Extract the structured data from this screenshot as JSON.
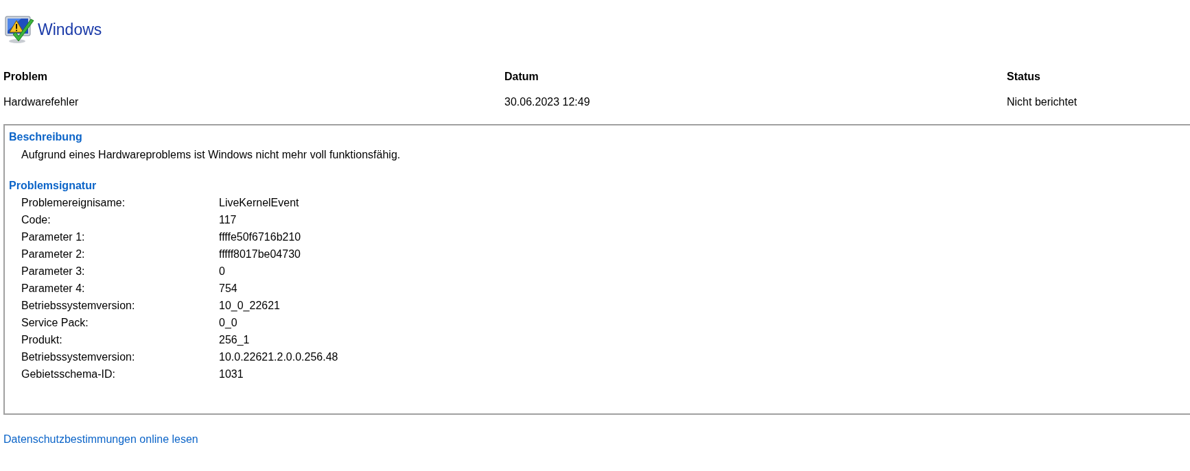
{
  "header": {
    "title": "Windows"
  },
  "columns": [
    {
      "heading": "Problem",
      "value": "Hardwarefehler"
    },
    {
      "heading": "Datum",
      "value": "30.06.2023 12:49"
    },
    {
      "heading": "Status",
      "value": "Nicht berichtet"
    }
  ],
  "details": {
    "description_heading": "Beschreibung",
    "description": "Aufgrund eines Hardwareproblems ist Windows nicht mehr voll funktionsfähig.",
    "signature_heading": "Problemsignatur",
    "signature": [
      {
        "label": "Problemereignisame:",
        "value": "LiveKernelEvent"
      },
      {
        "label": "Code:",
        "value": "117"
      },
      {
        "label": "Parameter 1:",
        "value": "ffffe50f6716b210"
      },
      {
        "label": "Parameter 2:",
        "value": "fffff8017be04730"
      },
      {
        "label": "Parameter 3:",
        "value": "0"
      },
      {
        "label": "Parameter 4:",
        "value": "754"
      },
      {
        "label": "Betriebssystemversion:",
        "value": "10_0_22621"
      },
      {
        "label": "Service Pack:",
        "value": "0_0"
      },
      {
        "label": "Produkt:",
        "value": "256_1"
      },
      {
        "label": "Betriebssystemversion:",
        "value": "10.0.22621.2.0.0.256.48"
      },
      {
        "label": "Gebietsschema-ID:",
        "value": "1031"
      }
    ]
  },
  "privacy_link": "Datenschutzbestimmungen online lesen"
}
